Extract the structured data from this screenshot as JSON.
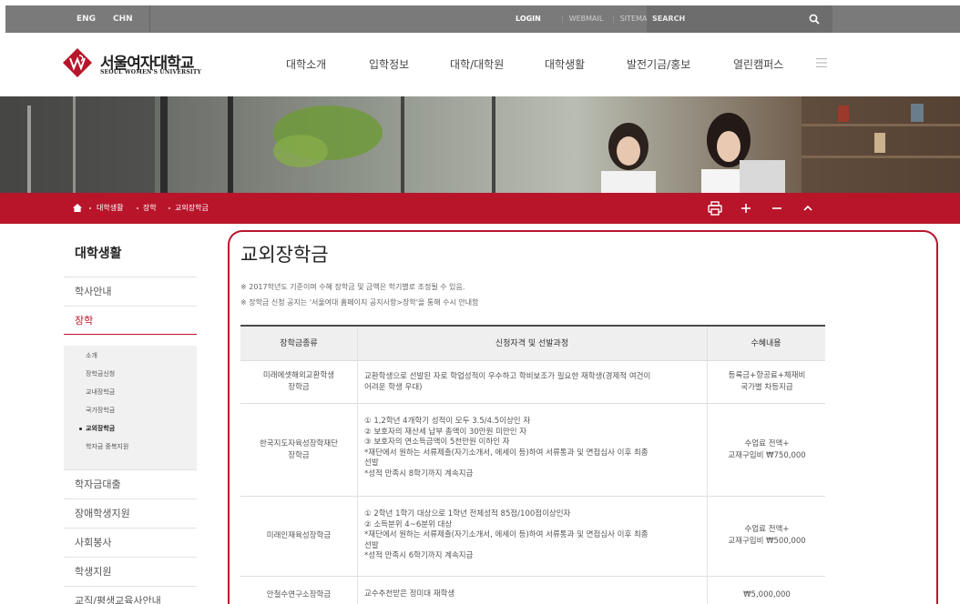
{
  "topbar": {
    "lang_eng": "ENG",
    "lang_chn": "CHN",
    "login": "LOGIN",
    "webmail": "WEBMAIL",
    "sitemap": "SITEMAP",
    "search_label": "SEARCH",
    "separator": "|"
  },
  "logo": {
    "korean": "서울여자대학교",
    "english": "SEOUL WOMEN'S UNIVERSITY"
  },
  "nav": [
    "대학소개",
    "입학정보",
    "대학/대학원",
    "대학생활",
    "발전기금/홍보",
    "열린캠퍼스"
  ],
  "breadcrumb": [
    "대학생활",
    "장학",
    "교외장학금"
  ],
  "sidebar": {
    "title": "대학생활",
    "items": [
      "학사안내",
      "장학",
      "학자금대출",
      "장애학생지원",
      "사회봉사",
      "학생지원",
      "교직/평생교육사안내"
    ],
    "sub_items": [
      "소개",
      "장학금신청",
      "교내장학금",
      "국가장학금",
      "교외장학금",
      "학자금 중복지원"
    ]
  },
  "main": {
    "title": "교외장학금",
    "notes": [
      "※ 2017학년도 기준이며 수혜 장학금 및 금액은 학기별로 조정될 수 있음.",
      "※ 장학금 신청 공지는 '서울여대 홈페이지 공지사항>장학'을 통해 수시 안내함"
    ],
    "table": {
      "headers": [
        "장학금종류",
        "신청자격 및 선발과정",
        "수혜내용"
      ],
      "rows": [
        {
          "name": [
            "미래에셋해외교환학생",
            "장학금"
          ],
          "criteria": [
            "교환학생으로 선발된 자로 학업성적이 우수하고 학비보조가 필요한 재학생(경제적 여건이",
            "어려운 학생 우대)"
          ],
          "benefit": [
            "등록금+항공료+체재비",
            "국가별 차등지급"
          ]
        },
        {
          "name": [
            "한국지도자육성장학재단",
            "장학금"
          ],
          "criteria": [
            "① 1,2학년 4개학기 성적이 모두 3.5/4.5이상인 자",
            "② 보호자의 재산세 납부 총액이 30만원 미만인 자",
            "③ 보호자의 연소득금액이 5천만원 이하인 자",
            "*재단에서 원하는 서류제출(자기소개서, 에세이 등)하여 서류통과 및 면접심사 이후 최종",
            "선발",
            "*성적 만족시 8학기까지 계속지급"
          ],
          "benefit": [
            "수업료 전액+",
            "교재구입비 ₩750,000"
          ]
        },
        {
          "name": [
            "미래인재육성장학금"
          ],
          "criteria": [
            "① 2학년 1학기 대상으로 1학년 전체성적 85점/100점이상인자",
            "② 소득분위 4~6분위 대상",
            "*재단에서 원하는 서류제출(자기소개서, 에세이 등)하여 서류통과 및 면접심사 이후 최종",
            "선발",
            "*성적 만족시 6학기까지 계속지급"
          ],
          "benefit": [
            "수업료 전액+",
            "교재구입비 ₩500,000"
          ]
        },
        {
          "name": [
            "안철수연구소장학금"
          ],
          "criteria": [
            "교수추천받은 정미대 재학생"
          ],
          "benefit": [
            "₩5,000,000"
          ]
        }
      ]
    }
  },
  "colors": {
    "brand_red": "#b8152b",
    "topbar_gray": "#7a7a7a"
  },
  "icons": [
    "search-icon",
    "menu-icon",
    "home-icon",
    "print-icon",
    "zoom-in-icon",
    "zoom-out-icon",
    "scroll-top-icon"
  ]
}
